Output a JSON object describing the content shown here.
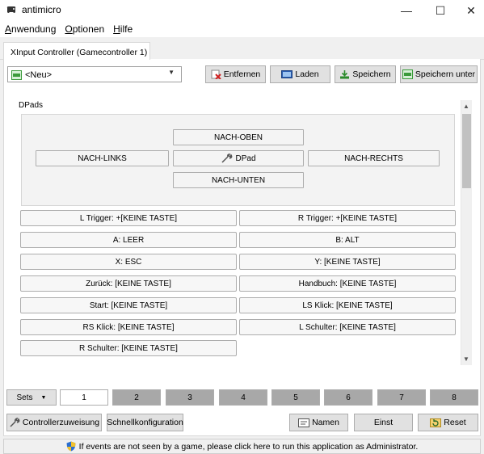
{
  "window": {
    "title": "antimicro",
    "minimize_glyph": "—",
    "maximize_glyph": "☐",
    "close_glyph": "✕"
  },
  "menu": [
    "Anwendung",
    "Optionen",
    "Hilfe"
  ],
  "tab": {
    "label": "XInput Controller (Gamecontroller 1)"
  },
  "profile": {
    "selected": "<Neu>",
    "remove_label": "Entfernen",
    "load_label": "Laden",
    "save_label": "Speichern",
    "save_as_label": "Speichern unter"
  },
  "dpads": {
    "group_title": "DPads",
    "up": "NACH-OBEN",
    "left": "NACH-LINKS",
    "center": "DPad",
    "right": "NACH-RECHTS",
    "down": "NACH-UNTEN"
  },
  "buttons": [
    "L Trigger: +[KEINE TASTE]",
    "R Trigger: +[KEINE TASTE]",
    "A: LEER",
    "B: ALT",
    "X: ESC",
    "Y: [KEINE TASTE]",
    "Zurück: [KEINE TASTE]",
    "Handbuch: [KEINE TASTE]",
    "Start: [KEINE TASTE]",
    "LS Klick: [KEINE TASTE]",
    "RS Klick: [KEINE TASTE]",
    "L Schulter: [KEINE TASTE]",
    "R Schulter: [KEINE TASTE]"
  ],
  "sets": {
    "dropdown_label": "Sets",
    "items": [
      "1",
      "2",
      "3",
      "4",
      "5",
      "6",
      "7",
      "8"
    ],
    "active": "1"
  },
  "bottom": {
    "controller_mapping": "Controllerzuweisung",
    "quick_config": "Schnellkonfiguration",
    "names": "Namen",
    "settings": "Einst",
    "reset": "Reset"
  },
  "status": {
    "message": "If events are not seen by a game, please click here to run this application as Administrator."
  },
  "colors": {
    "set_inactive": "#a8a8a8",
    "set_active": "#ffffff",
    "button_face": "#e1e1e1",
    "panel": "#ffffff"
  }
}
